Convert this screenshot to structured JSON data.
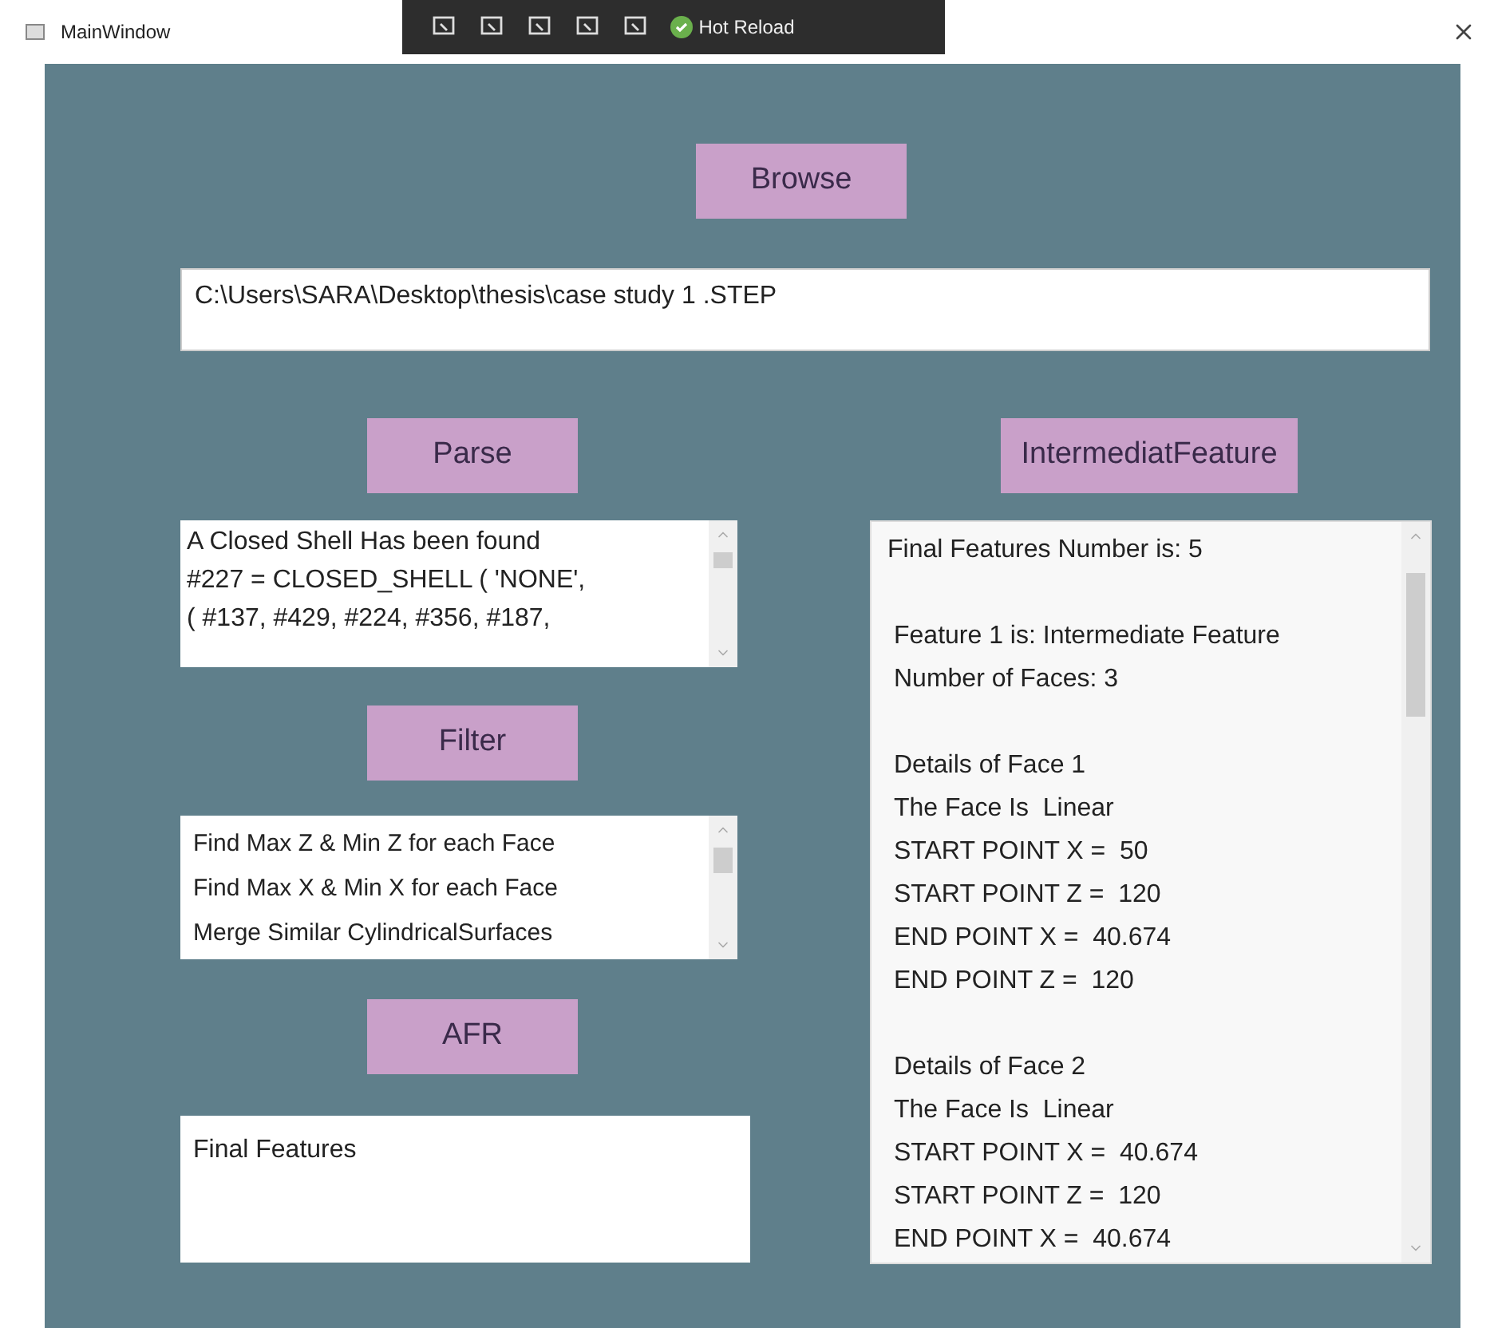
{
  "window": {
    "title": "MainWindow",
    "debug_toolbar": {
      "hot_reload": "Hot Reload"
    }
  },
  "browse_button": "Browse",
  "file_path": {
    "value": "C:\\Users\\SARA\\Desktop\\thesis\\case study 1 .STEP"
  },
  "parse": {
    "button": "Parse",
    "output": [
      "A Closed Shell Has been found",
      "#227 = CLOSED_SHELL ( 'NONE',",
      "( #137, #429, #224, #356, #187,"
    ]
  },
  "filter": {
    "button": "Filter",
    "steps": [
      "Find Max Z & Min Z for each Face",
      "Find Max X & Min X for each Face",
      "Merge Similar CylindricalSurfaces"
    ]
  },
  "afr": {
    "button": "AFR",
    "output": [
      "Final Features"
    ]
  },
  "intermediate": {
    "button": "IntermediatFeature",
    "paragraphs": [
      [
        "Final Features Number is: 5"
      ],
      [
        "Feature 1 is: Intermediate Feature",
        "Number of Faces: 3"
      ],
      [
        "Details of Face 1",
        "The Face Is  Linear",
        "START POINT X =  50",
        "START POINT Z =  120",
        "END POINT X =  40.674",
        "END POINT Z =  120"
      ],
      [
        "Details of Face 2",
        "The Face Is  Linear",
        "START POINT X =  40.674",
        "START POINT Z =  120",
        "END POINT X =  40.674"
      ]
    ]
  }
}
